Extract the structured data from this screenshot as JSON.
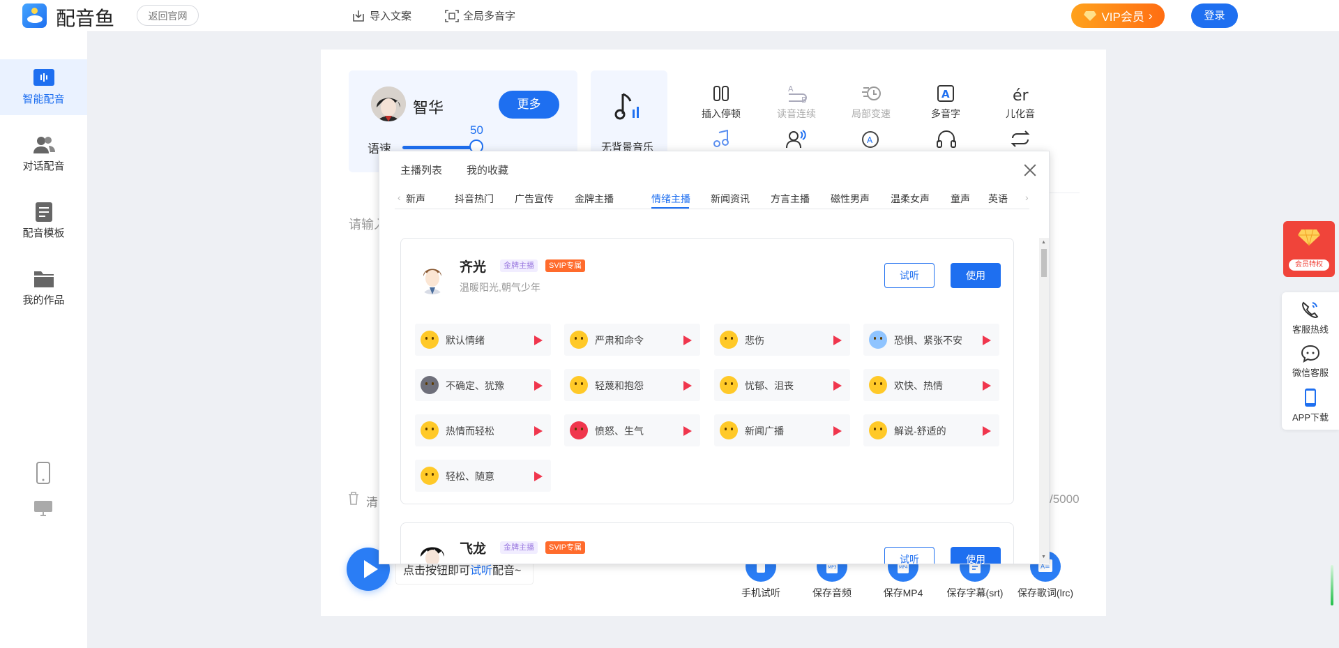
{
  "header": {
    "app_name": "配音鱼",
    "back_label": "返回官网",
    "import_label": "导入文案",
    "polyphone_label": "全局多音字",
    "vip_label": "VIP会员",
    "login_label": "登录"
  },
  "sidebar": {
    "items": [
      {
        "label": "智能配音"
      },
      {
        "label": "对话配音"
      },
      {
        "label": "配音模板"
      },
      {
        "label": "我的作品"
      }
    ]
  },
  "editor": {
    "voice_name": "智华",
    "more_label": "更多",
    "speed_label": "语速",
    "speed_value": "50",
    "bgm_label": "无背景音乐",
    "tools_row1": [
      "插入停顿",
      "读音连续",
      "局部变速",
      "多音字",
      "儿化音"
    ],
    "input_placeholder_fragment": "请输入",
    "clear_fragment": "清",
    "count_fragment": "/5000",
    "hint_prefix": "点击按钮即可",
    "hint_link": "试听",
    "hint_suffix": "配音~",
    "actions": [
      "手机试听",
      "保存音频",
      "保存MP4",
      "保存字幕(srt)",
      "保存歌词(lrc)"
    ]
  },
  "modal": {
    "tabs": [
      "主播列表",
      "我的收藏"
    ],
    "categories": [
      "新声",
      "抖音热门",
      "广告宣传",
      "金牌主播",
      "情绪主播",
      "新闻资讯",
      "方言主播",
      "磁性男声",
      "温柔女声",
      "童声",
      "英语"
    ],
    "active_category": "情绪主播",
    "voices": [
      {
        "name": "齐光",
        "badge_gold": "金牌主播",
        "badge_svip": "SVIP专属",
        "desc": "温暖阳光,朝气少年",
        "try_label": "试听",
        "use_label": "使用",
        "emotions": [
          "默认情绪",
          "严肃和命令",
          "悲伤",
          "恐惧、紧张不安",
          "不确定、犹豫",
          "轻蔑和抱怨",
          "忧郁、沮丧",
          "欢快、热情",
          "热情而轻松",
          "愤怒、生气",
          "新闻广播",
          "解说-舒适的",
          "轻松、随意"
        ]
      },
      {
        "name": "飞龙",
        "badge_gold": "金牌主播",
        "badge_svip": "SVIP专属",
        "try_label": "试听",
        "use_label": "使用"
      }
    ]
  },
  "float": {
    "promo_label": "会员特权",
    "hotline_label": "客服热线",
    "wechat_label": "微信客服",
    "app_label": "APP下载"
  }
}
